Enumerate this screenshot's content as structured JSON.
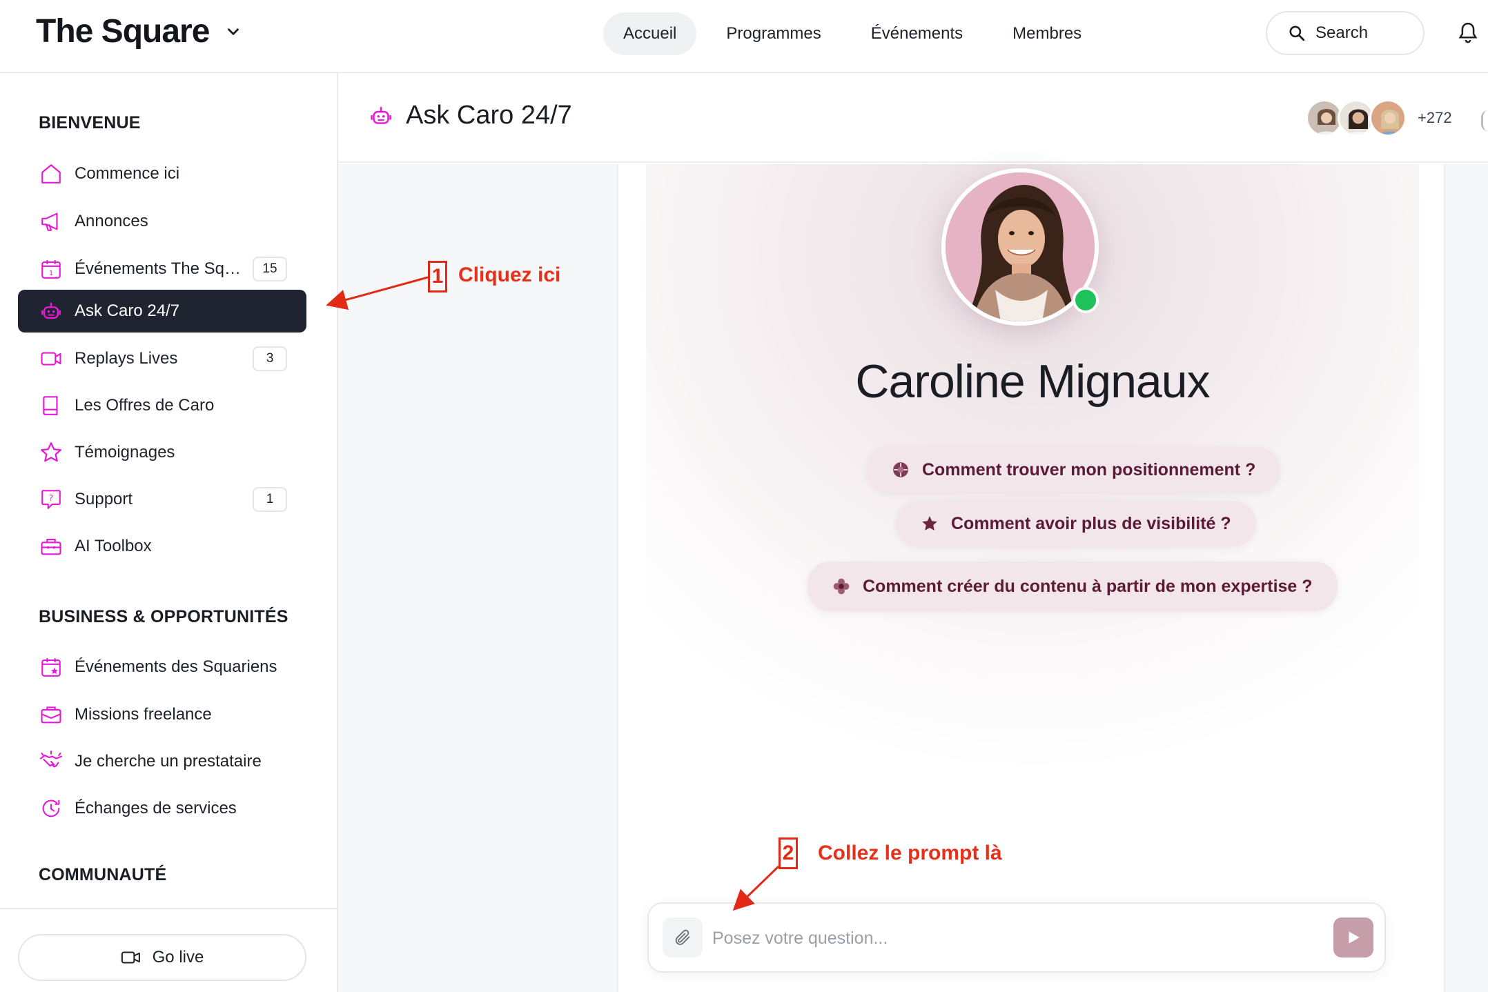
{
  "header": {
    "brand": "The Square",
    "nav": [
      "Accueil",
      "Programmes",
      "Événements",
      "Membres"
    ],
    "search_label": "Search",
    "icons": {
      "brand_menu": "chevron-down-icon",
      "search": "search-icon",
      "notifications": "bell-icon"
    }
  },
  "sidebar": {
    "sections": [
      {
        "title": "BIENVENUE",
        "items": [
          {
            "label": "Commence ici",
            "icon": "home-icon"
          },
          {
            "label": "Annonces",
            "icon": "megaphone-icon"
          },
          {
            "label": "Événements The Square",
            "icon": "calendar-icon",
            "badge": "15"
          },
          {
            "label": "Ask Caro 24/7",
            "icon": "robot-icon",
            "active": true
          },
          {
            "label": "Replays Lives",
            "icon": "video-icon",
            "badge": "3"
          },
          {
            "label": "Les Offres de Caro",
            "icon": "book-icon"
          },
          {
            "label": "Témoignages",
            "icon": "star-icon"
          },
          {
            "label": "Support",
            "icon": "help-chat-icon",
            "badge": "1"
          },
          {
            "label": "AI Toolbox",
            "icon": "toolbox-icon"
          }
        ]
      },
      {
        "title": "BUSINESS & OPPORTUNITÉS",
        "items": [
          {
            "label": "Événements des Squariens",
            "icon": "calendar-star-icon"
          },
          {
            "label": "Missions freelance",
            "icon": "briefcase-icon"
          },
          {
            "label": "Je cherche un prestataire",
            "icon": "handshake-icon"
          },
          {
            "label": "Échanges de services",
            "icon": "clock-exchange-icon"
          }
        ]
      },
      {
        "title": "COMMUNAUTÉ",
        "items": []
      }
    ],
    "footer": {
      "go_live_label": "Go live",
      "icon": "video-camera-icon"
    }
  },
  "main": {
    "title": "Ask Caro 24/7",
    "title_icon": "robot-icon",
    "members_count": "+272",
    "profile_name": "Caroline Mignaux",
    "status": "online",
    "suggestions": [
      {
        "label": "Comment trouver mon positionnement ?",
        "icon": "target-icon"
      },
      {
        "label": "Comment avoir plus de visibilité ?",
        "icon": "star-burst-icon"
      },
      {
        "label": "Comment créer du contenu à partir de mon expertise ?",
        "icon": "flower-icon"
      }
    ],
    "composer": {
      "placeholder": "Posez votre question...",
      "value": "",
      "attach_icon": "paperclip-icon",
      "send_icon": "send-icon"
    }
  },
  "annotations": [
    {
      "number": "1",
      "text": "Cliquez ici"
    },
    {
      "number": "2",
      "text": "Collez le prompt là"
    }
  ],
  "colors": {
    "accent_magenta": "#e61ad6",
    "active_nav_bg": "#1f2430",
    "chip_bg": "#f2e6ea",
    "chip_text": "#5b1b34",
    "send_bg": "#c59ea9",
    "online_green": "#1fc15a",
    "annotation_red": "#e22a16"
  }
}
